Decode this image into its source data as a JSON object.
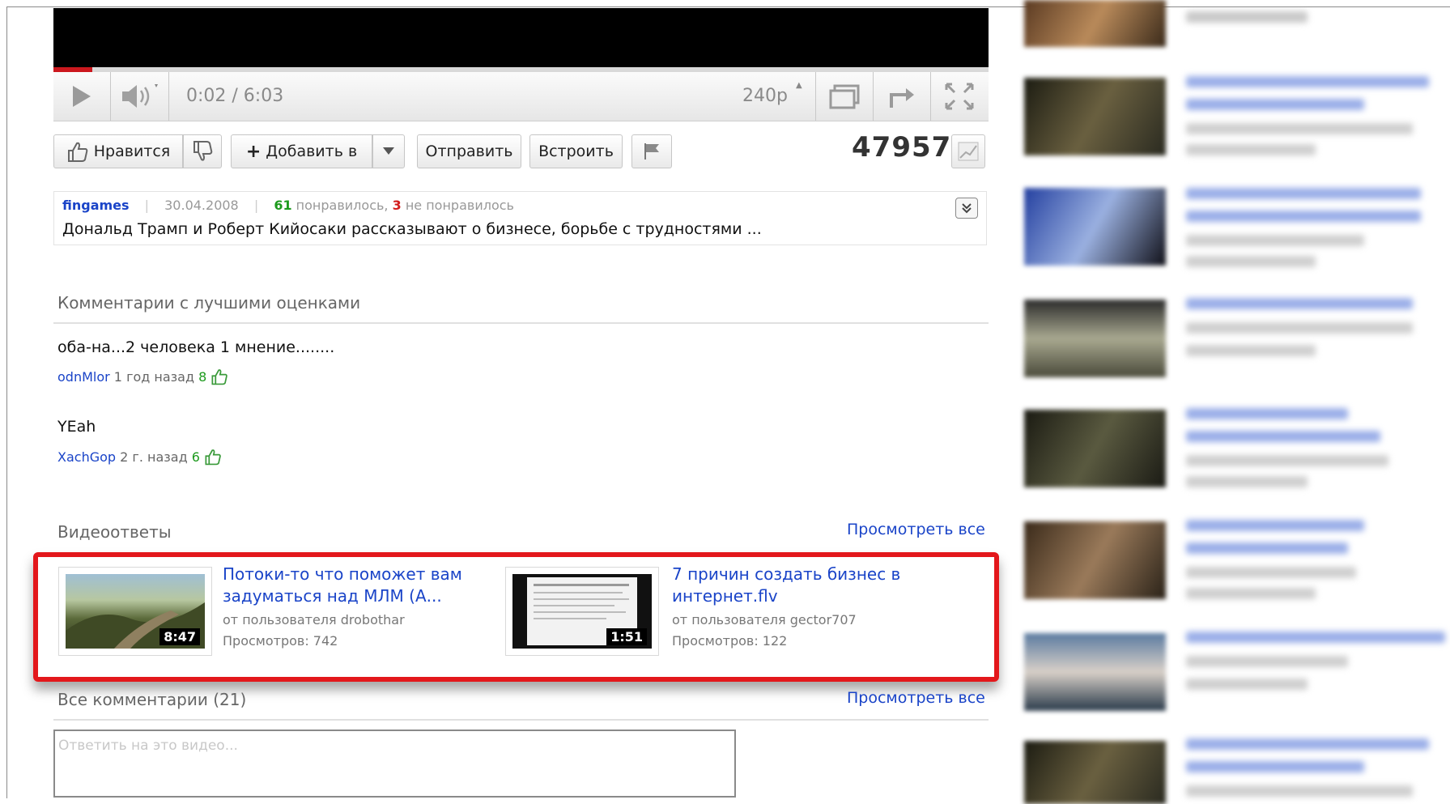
{
  "player": {
    "time": "0:02 / 6:03",
    "quality": "240p",
    "progress_fraction": 0.04
  },
  "actions": {
    "like_label": "Нравится",
    "add_label": "Добавить в",
    "send_label": "Отправить",
    "embed_label": "Встроить",
    "view_count": "47957"
  },
  "info": {
    "author": "fingames",
    "date": "30.04.2008",
    "likes": "61",
    "likes_text": "понравилось,",
    "dislikes": "3",
    "dislikes_text": "не понравилось",
    "description": "Дональд Трамп и Роберт Кийосаки рассказывают о бизнесе, борьбе с трудностями ..."
  },
  "top_comments": {
    "title": "Комментарии с лучшими оценками",
    "items": [
      {
        "text": "оба-на...2 человека 1 мнение........",
        "user": "odnMlor",
        "time": "1 год назад",
        "score": "8"
      },
      {
        "text": "YEah",
        "user": "XachGop",
        "time": "2 г. назад",
        "score": "6"
      }
    ]
  },
  "video_responses": {
    "title": "Видеоответы",
    "view_all": "Просмотреть все",
    "items": [
      {
        "title": "Потоки-то что поможет вам задуматься над МЛМ (А...",
        "by": "от пользователя drobothar",
        "views": "Просмотров: 742",
        "duration": "8:47"
      },
      {
        "title": "7 причин создать бизнес в интернет.flv",
        "by": "от пользователя gector707",
        "views": "Просмотров: 122",
        "duration": "1:51"
      }
    ]
  },
  "all_comments": {
    "title": "Все комментарии (21)",
    "view_all": "Просмотреть все",
    "reply_placeholder": "Ответить на это видео..."
  },
  "colors": {
    "link": "#1a44c8",
    "highlight": "#e3171b",
    "like": "#1d9a1d",
    "dislike": "#d21c1c"
  }
}
